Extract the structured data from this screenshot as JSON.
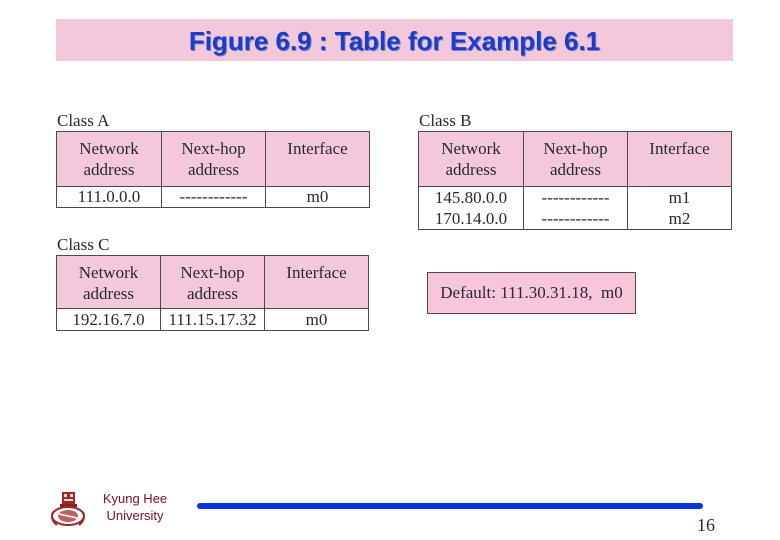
{
  "slide": {
    "title": "Figure 6.9 : Table for Example 6.1",
    "page_number": "16"
  },
  "colors": {
    "banner_bg": "#f2c8da",
    "title_text": "#1a3ccc",
    "header_bg": "#f2c8da",
    "university_text": "#7a1020",
    "rule": "#0a35d4"
  },
  "tables": {
    "class_a": {
      "label": "Class A",
      "headers": [
        {
          "line1": "Network",
          "line2": "address"
        },
        {
          "line1": "Next-hop",
          "line2": "address"
        },
        {
          "line1": "Interface",
          "line2": ""
        }
      ],
      "rows": [
        {
          "network": "111.0.0.0",
          "next_hop": "------------",
          "interface": "m0"
        }
      ]
    },
    "class_b": {
      "label": "Class B",
      "headers": [
        {
          "line1": "Network",
          "line2": "address"
        },
        {
          "line1": "Next-hop",
          "line2": "address"
        },
        {
          "line1": "Interface",
          "line2": ""
        }
      ],
      "rows": [
        {
          "network": "145.80.0.0",
          "next_hop": "------------",
          "interface": "m1"
        },
        {
          "network": "170.14.0.0",
          "next_hop": "------------",
          "interface": "m2"
        }
      ]
    },
    "class_c": {
      "label": "Class C",
      "headers": [
        {
          "line1": "Network",
          "line2": "address"
        },
        {
          "line1": "Next-hop",
          "line2": "address"
        },
        {
          "line1": "Interface",
          "line2": ""
        }
      ],
      "rows": [
        {
          "network": "192.16.7.0",
          "next_hop": "111.15.17.32",
          "interface": "m0"
        }
      ]
    }
  },
  "default_route": "Default: 111.30.31.18,  m0",
  "footer": {
    "logo_icon": "kyung-hee-emblem-icon",
    "university_line1": "Kyung Hee",
    "university_line2": "University"
  }
}
